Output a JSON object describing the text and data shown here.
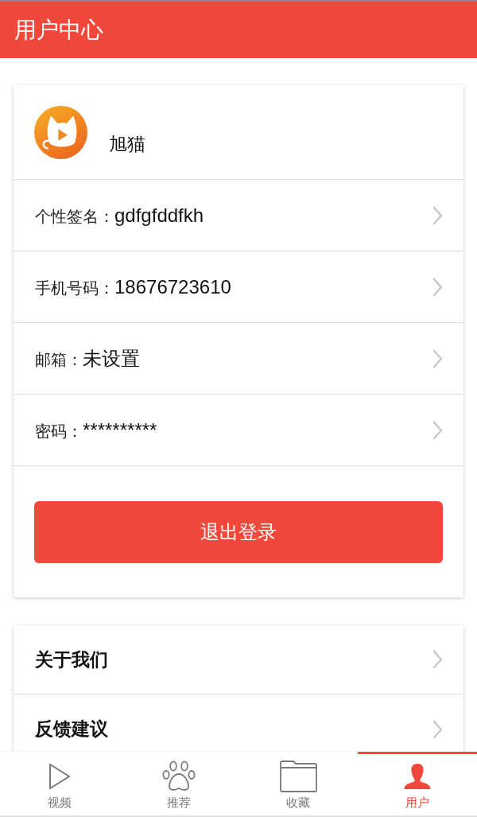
{
  "header": {
    "title": "用户中心"
  },
  "profile": {
    "name": "旭猫"
  },
  "info_rows": [
    {
      "label": "个性签名：",
      "value": "gdfgfddfkh"
    },
    {
      "label": "手机号码：",
      "value": "18676723610"
    },
    {
      "label": "邮箱：",
      "value": "未设置"
    },
    {
      "label": "密码：",
      "value": "**********"
    }
  ],
  "logout_button": {
    "label": "退出登录"
  },
  "menu_items": [
    {
      "label": "关于我们"
    },
    {
      "label": "反馈建议"
    }
  ],
  "tabs": [
    {
      "label": "视频",
      "selected": false
    },
    {
      "label": "推荐",
      "selected": false
    },
    {
      "label": "收藏",
      "selected": false
    },
    {
      "label": "用户",
      "selected": true
    }
  ]
}
